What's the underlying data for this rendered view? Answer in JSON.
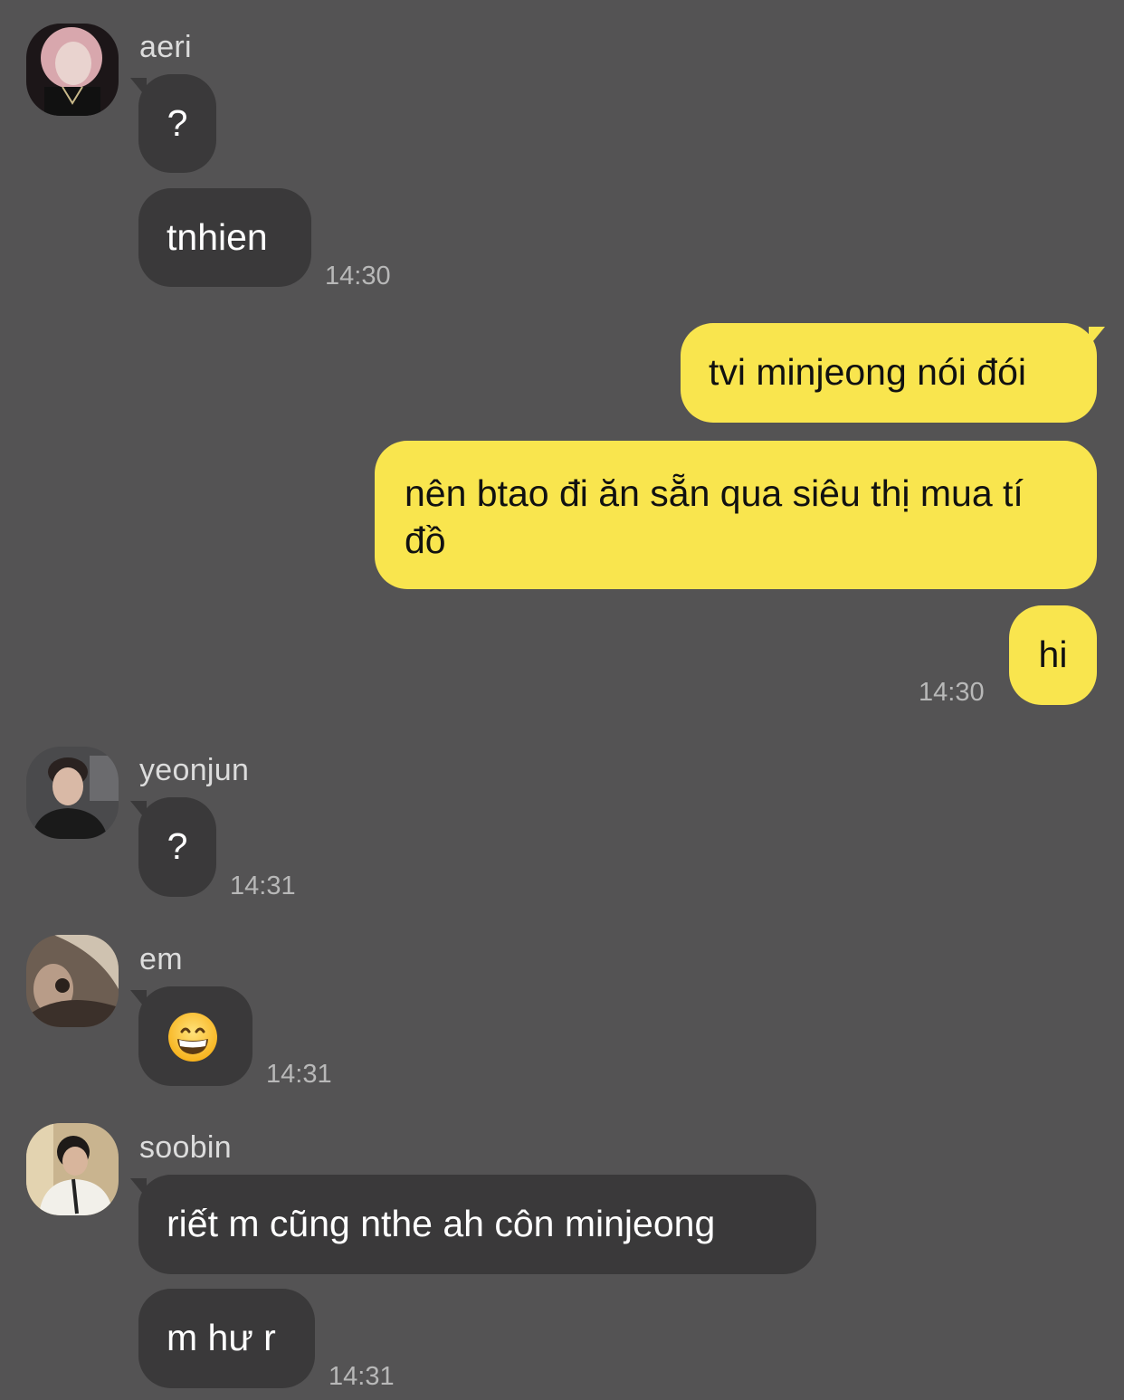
{
  "colors": {
    "background": "#545354",
    "incoming_bubble": "#3a393a",
    "outgoing_bubble": "#f9e54e"
  },
  "messages": {
    "aeri": {
      "name": "aeri",
      "avatar_icon": "aeri-avatar",
      "bubbles": [
        "?",
        "tnhien"
      ],
      "time": "14:30"
    },
    "me": {
      "bubbles": [
        "tvi minjeong nói đói",
        "nên btao đi ăn sẵn qua siêu thị mua tí đồ",
        "hi"
      ],
      "time": "14:30"
    },
    "yeonjun": {
      "name": "yeonjun",
      "avatar_icon": "yeonjun-avatar",
      "bubbles": [
        "?"
      ],
      "time": "14:31"
    },
    "em": {
      "name": "em",
      "avatar_icon": "em-avatar",
      "bubbles_icon": "grinning-face-emoji",
      "time": "14:31"
    },
    "soobin": {
      "name": "soobin",
      "avatar_icon": "soobin-avatar",
      "bubbles": [
        "riết m cũng nthe ah côn minjeong",
        "m hư r"
      ],
      "time": "14:31"
    }
  }
}
